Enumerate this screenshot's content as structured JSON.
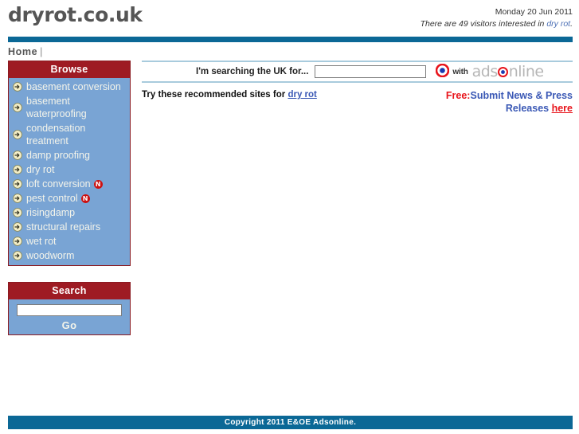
{
  "header": {
    "site_title": "dryrot.co.uk",
    "date": "Monday 20 Jun 2011",
    "visitors_prefix": "There are 49 visitors interested in ",
    "visitors_link": "dry rot",
    "visitors_suffix": ".",
    "visitor_count": 49
  },
  "nav": {
    "home_label": "Home",
    "separator": "|"
  },
  "sidebar": {
    "browse": {
      "title": "Browse",
      "items": [
        {
          "label": "basement conversion",
          "badge": ""
        },
        {
          "label": "basement waterproofing",
          "badge": ""
        },
        {
          "label": "condensation treatment",
          "badge": ""
        },
        {
          "label": "damp proofing",
          "badge": ""
        },
        {
          "label": "dry rot",
          "badge": ""
        },
        {
          "label": "loft conversion",
          "badge": "N"
        },
        {
          "label": "pest control",
          "badge": "N"
        },
        {
          "label": "risingdamp",
          "badge": ""
        },
        {
          "label": "structural repairs",
          "badge": ""
        },
        {
          "label": "wet rot",
          "badge": ""
        },
        {
          "label": "woodworm",
          "badge": ""
        }
      ]
    },
    "search": {
      "title": "Search",
      "input_value": "",
      "input_placeholder": "",
      "go_label": "Go"
    }
  },
  "main": {
    "searchbar": {
      "label": "I'm searching the UK for...",
      "input_value": "",
      "input_placeholder": "",
      "with_label": "with",
      "brand_part1": "ads",
      "brand_part2": "nline",
      "bullseye_icon": "target-icon"
    },
    "recommend": {
      "prefix": "Try these recommended sites for ",
      "keyword": "dry rot"
    },
    "promo": {
      "free_label": "Free:",
      "line1": "Submit News & Press",
      "line2": "Releases ",
      "here_label": "here"
    }
  },
  "footer": {
    "copyright": "Copyright 2011 E&OE Adsonline."
  },
  "colors": {
    "blue_bar": "#0b6896",
    "panel_header": "#9e1b23",
    "panel_body": "#79a4d4",
    "link_blue": "#3a58b5",
    "red": "#e8141b",
    "rule_blue": "#a8cbdd"
  }
}
